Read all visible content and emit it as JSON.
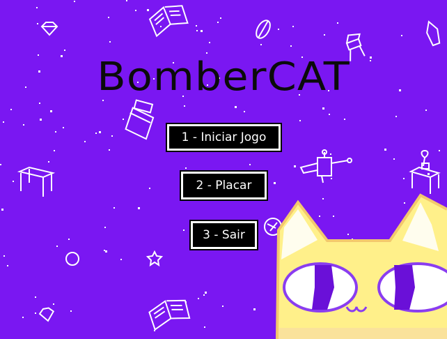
{
  "game": {
    "title": "BomberCAT"
  },
  "menu": {
    "items": [
      {
        "label": "1 - Iniciar Jogo"
      },
      {
        "label": "2 - Placar"
      },
      {
        "label": "3 - Sair"
      }
    ]
  },
  "colors": {
    "background": "#7a17f2",
    "button_bg": "#000000",
    "button_text": "#ffffff",
    "cat_fill": "#fff08a",
    "cat_eye": "#6a10d8"
  }
}
